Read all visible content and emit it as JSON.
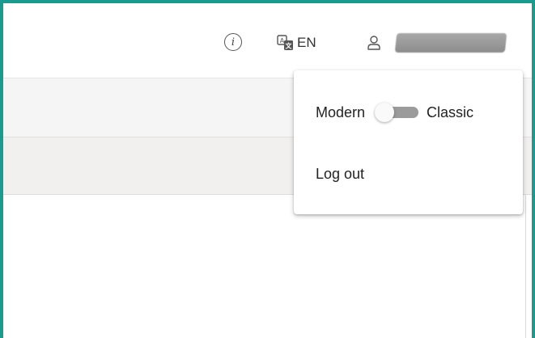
{
  "header": {
    "info_icon_glyph": "i",
    "language": {
      "icon": "translate-icon",
      "label": "EN"
    },
    "user": {
      "icon": "user-icon",
      "name_redacted": true
    }
  },
  "user_menu": {
    "view_mode": {
      "left_label": "Modern",
      "right_label": "Classic",
      "selected": "Modern"
    },
    "logout_label": "Log out"
  },
  "colors": {
    "frame_border": "#1b9a90",
    "switch_track": "#9b9b9b",
    "switch_thumb": "#fafafa"
  }
}
